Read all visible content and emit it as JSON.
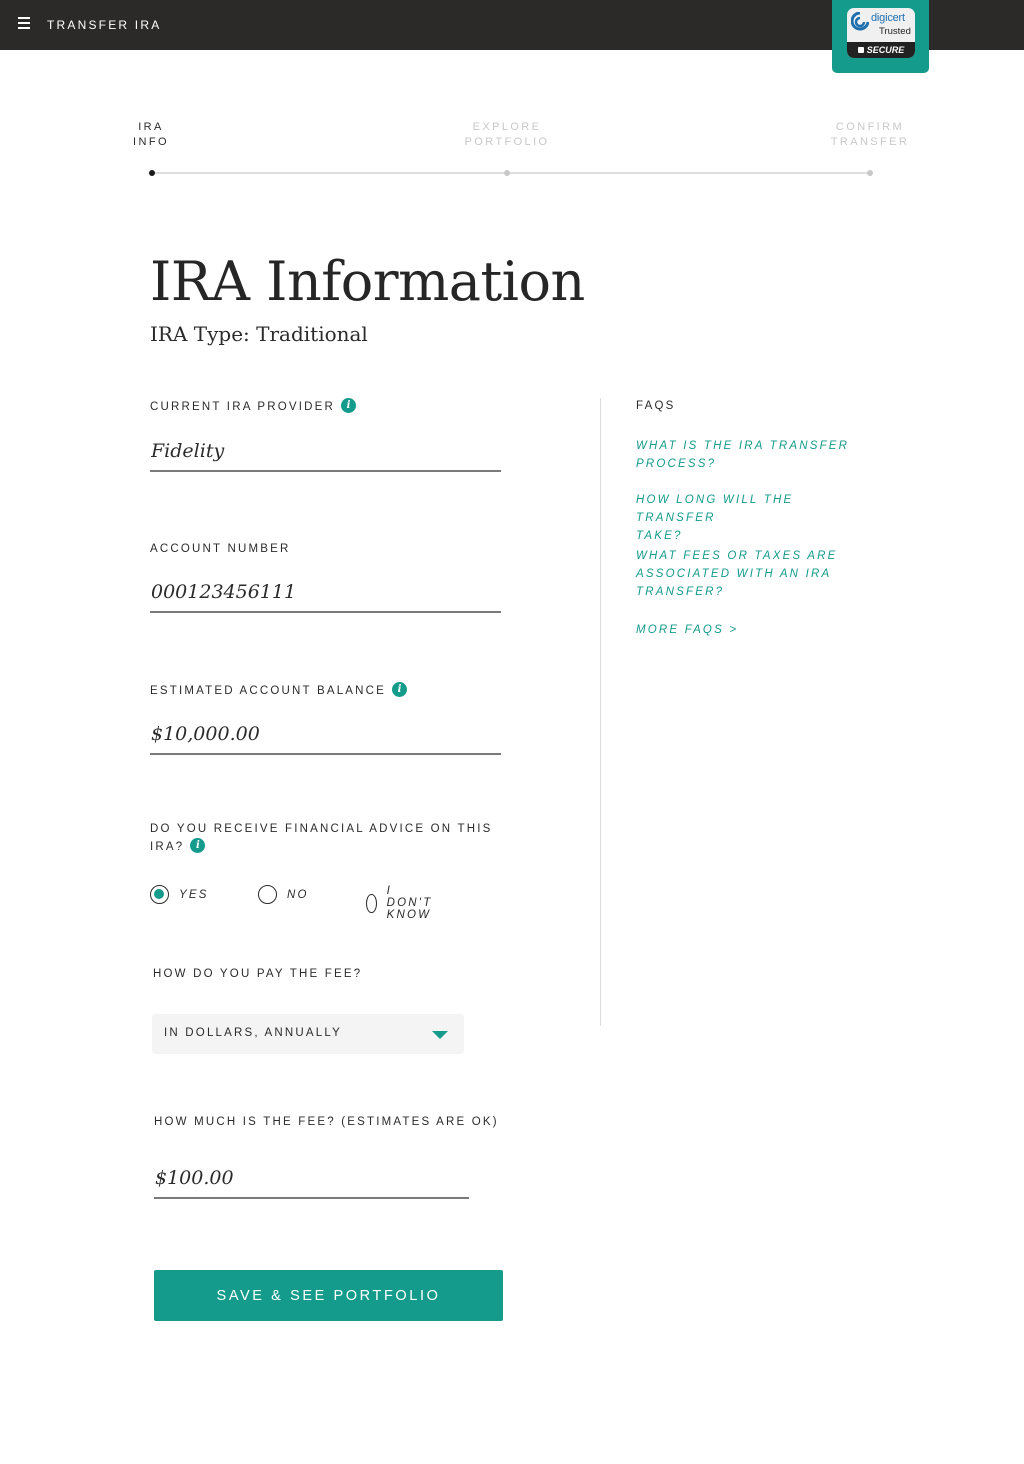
{
  "header": {
    "title": "TRANSFER IRA",
    "badge": {
      "brand": "digicert",
      "trusted": "Trusted",
      "secure": "SECURE"
    }
  },
  "steps": [
    {
      "line1": "IRA",
      "line2": "INFO",
      "active": true
    },
    {
      "line1": "EXPLORE",
      "line2": "PORTFOLIO",
      "active": false
    },
    {
      "line1": "CONFIRM",
      "line2": "TRANSFER",
      "active": false
    }
  ],
  "page": {
    "title": "IRA Information",
    "subtitle": "IRA Type: Traditional"
  },
  "form": {
    "provider_label": "CURRENT IRA PROVIDER",
    "provider_value": "Fidelity",
    "account_label": "ACCOUNT NUMBER",
    "account_value": "000123456111",
    "balance_label": "ESTIMATED ACCOUNT BALANCE",
    "balance_value": "$10,000.00",
    "advice_label_line1": "DO YOU RECEIVE FINANCIAL ADVICE ON THIS",
    "advice_label_line2": "IRA?",
    "advice_options": [
      "YES",
      "NO",
      "I DON'T KNOW"
    ],
    "advice_selected": "YES",
    "fee_method_label": "HOW DO YOU PAY THE FEE?",
    "fee_method_value": "IN DOLLARS, ANNUALLY",
    "fee_amount_label": "HOW MUCH IS THE FEE? (ESTIMATES ARE OK)",
    "fee_amount_value": "$100.00",
    "submit_label": "SAVE & SEE PORTFOLIO"
  },
  "faqs": {
    "title": "FAQS",
    "items": [
      {
        "line1": "WHAT IS THE IRA TRANSFER",
        "line2": "PROCESS?"
      },
      {
        "line1": "HOW LONG WILL THE TRANSFER",
        "line2": "TAKE?"
      },
      {
        "line1": "WHAT FEES OR TAXES ARE",
        "line2": "ASSOCIATED WITH AN IRA",
        "line3": "TRANSFER?"
      }
    ],
    "more_label": "MORE FAQS >"
  },
  "colors": {
    "accent": "#149b8b",
    "topbar": "#2b2a29",
    "inactive_step": "#c8c8c8"
  }
}
